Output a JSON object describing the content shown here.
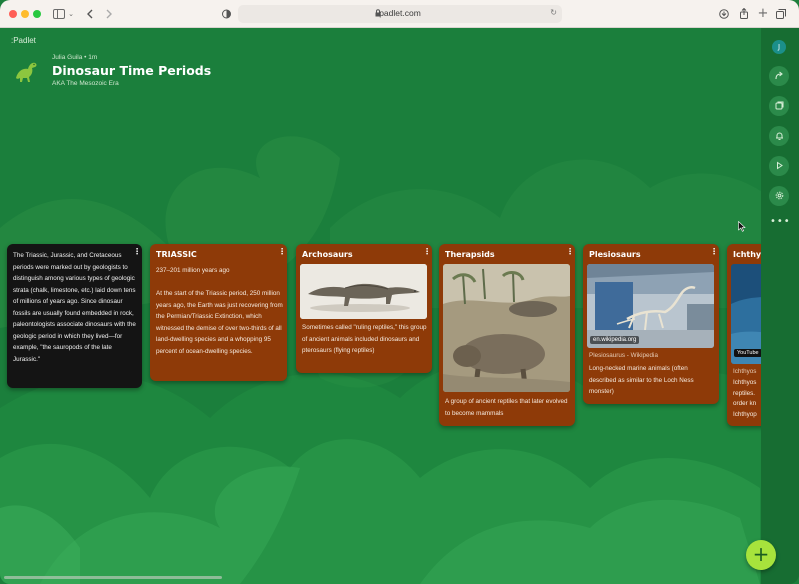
{
  "browser": {
    "url": "padlet.com",
    "colors": {
      "close": "#ff5f57",
      "minimize": "#febc2e",
      "maximize": "#28c840"
    },
    "icons": [
      "sidebar-icon",
      "chevron-down-icon",
      "back-icon",
      "forward-icon",
      "shield-icon",
      "lock-icon",
      "reload-icon",
      "download-icon",
      "share-icon",
      "new-tab-icon",
      "tabs-icon"
    ]
  },
  "header": {
    "brand": ":Padlet",
    "author": "Julia Guila",
    "time": "• 1m",
    "title": "Dinosaur Time Periods",
    "subtitle": "AKA The Mesozoic Era"
  },
  "rail": {
    "avatar_letter": "J",
    "icons": [
      "share-icon",
      "remake-icon",
      "notification-icon",
      "slideshow-icon",
      "settings-icon",
      "more-icon"
    ],
    "more": "•••"
  },
  "fab": {
    "label": "+"
  },
  "cards": [
    {
      "id": "intro",
      "text": "The Triassic, Jurassic, and Cretaceous periods were marked out by geologists to distinguish among various types of geologic strata (chalk, limestone, etc.) laid down tens of millions of years ago. Since dinosaur fossils are usually found embedded in rock, paleontologists associate dinosaurs with the geologic period in which they lived—for example, \"the sauropods of the late Jurassic.\""
    },
    {
      "id": "triassic",
      "title": "TRIASSIC",
      "dates": "237–201 million years ago",
      "text": "At the start of the Triassic period, 250 million years ago, the Earth was just recovering from the Permian/Triassic Extinction, which witnessed the demise of over two-thirds of all land-dwelling species and a whopping 95 percent of ocean-dwelling species."
    },
    {
      "id": "archosaurs",
      "title": "Archosaurs",
      "caption": "Sometimes called \"ruling reptiles,\" this group of ancient animals included dinosaurs and pterosaurs (flying reptiles)"
    },
    {
      "id": "therapsids",
      "title": "Therapsids",
      "caption": "A group of ancient reptiles that later evolved to become mammals"
    },
    {
      "id": "plesiosaurs",
      "title": "Plesiosaurs",
      "link_domain": "en.wikipedia.org",
      "link_title": "Plesiosaurus - Wikipedia",
      "caption": "Long-necked marine animals (often described as similar to the Loch Ness monster)"
    },
    {
      "id": "ichthyosaurs",
      "title": "Ichthyo",
      "badge": "YouTube",
      "source": "Ichthyos",
      "lines": [
        "Ichthyos",
        "reptiles.",
        "order kn",
        "Ichthyop"
      ]
    }
  ]
}
